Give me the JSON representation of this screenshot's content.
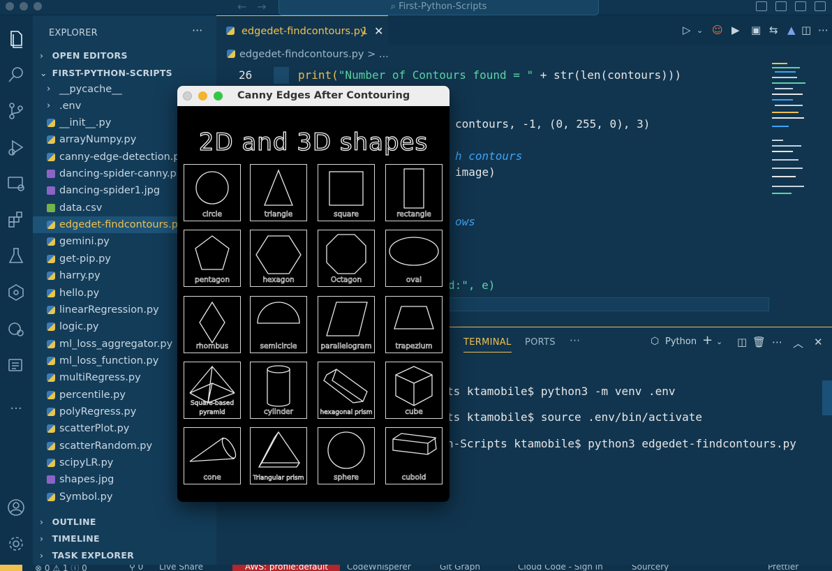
{
  "window": {
    "search_text": "First-Python-Scripts"
  },
  "sidebar": {
    "header": "EXPLORER",
    "more": "···",
    "open_editors": "OPEN EDITORS",
    "project": "FIRST-PYTHON-SCRIPTS",
    "folders": [
      "__pycache__",
      ".env"
    ],
    "files": [
      "__init__.py",
      "arrayNumpy.py",
      "canny-edge-detection.py",
      "dancing-spider-canny.png",
      "dancing-spider1.jpg",
      "data.csv",
      "edgedet-findcontours.py",
      "gemini.py",
      "get-pip.py",
      "harry.py",
      "hello.py",
      "linearRegression.py",
      "logic.py",
      "ml_loss_aggregator.py",
      "ml_loss_function.py",
      "multiRegress.py",
      "percentile.py",
      "polyRegress.py",
      "scatterPlot.py",
      "scatterRandom.py",
      "scipyLR.py",
      "shapes.jpg",
      "Symbol.py"
    ],
    "outline": "OUTLINE",
    "timeline": "TIMELINE",
    "task_explorer": "TASK EXPLORER"
  },
  "editor": {
    "tab_title": "edgedet-findcontours.py",
    "tab_badge": "1",
    "breadcrumb": "edgedet-findcontours.py > ...",
    "line_number": "26",
    "code_line_26_a": "print(",
    "code_line_26_b": "\"Number of Contours found = \"",
    "code_line_26_c": " + str(len(contours)))",
    "code_frag_1": "contours, -1, (0, 255, 0), 3)",
    "code_frag_2": "h contours",
    "code_frag_3": "image)",
    "code_frag_4": "ows",
    "code_frag_5": "d:\", e)"
  },
  "panel": {
    "tabs": [
      "TERMINAL",
      "PORTS"
    ],
    "more": "···",
    "shell": "Python",
    "term_lines": [
      "ts ktamobile$ python3 -m venv .env",
      "ts ktamobile$ source .env/bin/activate",
      "n-Scripts ktamobile$ python3 edgedet-findcontours.py"
    ]
  },
  "image_window": {
    "title": "Canny Edges After Contouring",
    "heading": "2D and 3D shapes",
    "shapes": [
      "circle",
      "triangle",
      "square",
      "rectangle",
      "pentagon",
      "hexagon",
      "Octagon",
      "oval",
      "rhombus",
      "semicircle",
      "parallelogram",
      "trapezium",
      "Square-based pyramid",
      "cylinder",
      "hexagonal prism",
      "cube",
      "cone",
      "Triangular prism",
      "sphere",
      "cuboid"
    ]
  },
  "status": {
    "aws": "AWS: profile:default",
    "items": [
      "Live Share",
      "CodeWhisperer",
      "Git Graph",
      "Cloud Code - Sign in",
      "Sourcery",
      "Prettier"
    ]
  },
  "colors": {
    "accent": "#f0c050",
    "bg": "#11354f",
    "sidebar": "#133c59",
    "activity": "#0e324b"
  }
}
